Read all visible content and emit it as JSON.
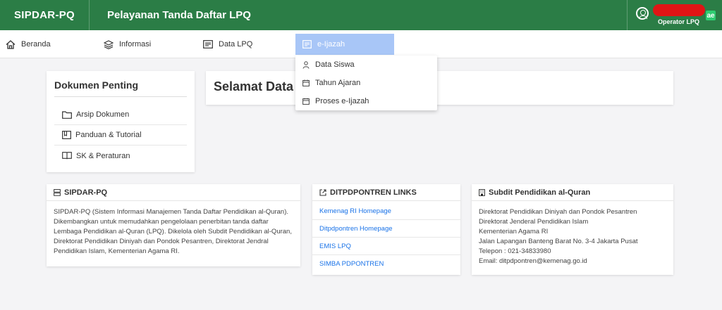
{
  "header": {
    "brand": "SIPDAR-PQ",
    "title": "Pelayanan Tanda Daftar LPQ",
    "user_role": "Operator LPQ",
    "app_badge": "ae"
  },
  "nav": {
    "items": [
      {
        "label": "Beranda",
        "icon": "home-icon"
      },
      {
        "label": "Informasi",
        "icon": "layers-icon"
      },
      {
        "label": "Data LPQ",
        "icon": "list-box-icon"
      },
      {
        "label": "e-Ijazah",
        "icon": "document-icon",
        "active": true
      }
    ]
  },
  "dropdown": {
    "items": [
      {
        "label": "Data Siswa",
        "icon": "person-icon"
      },
      {
        "label": "Tahun Ajaran",
        "icon": "calendar-icon"
      },
      {
        "label": "Proses e-Ijazah",
        "icon": "calendar-icon"
      }
    ]
  },
  "dokumen": {
    "title": "Dokumen Penting",
    "items": [
      {
        "label": "Arsip Dokumen",
        "icon": "folder-icon"
      },
      {
        "label": "Panduan & Tutorial",
        "icon": "book-icon"
      },
      {
        "label": "SK & Peraturan",
        "icon": "open-book-icon"
      }
    ]
  },
  "welcome": {
    "text": "Selamat Data"
  },
  "sipdar_card": {
    "title": "SIPDAR-PQ",
    "body": "SIPDAR-PQ (Sistem Informasi Manajemen Tanda Daftar Pendidikan al-Quran). Dikembangkan untuk memudahkan pengelolaan penerbitan tanda daftar Lembaga Pendidikan al-Quran (LPQ). Dikelola oleh Subdit Pendidikan al-Quran, Direktorat Pendidikan Diniyah dan Pondok Pesantren, Direktorat Jendral Pendidikan Islam, Kementerian Agama RI."
  },
  "links_card": {
    "title": "DITPDPONTREN LINKS",
    "links": [
      "Kemenag RI Homepage",
      "Ditpdpontren Homepage",
      "EMIS LPQ",
      "SIMBA PDPONTREN"
    ]
  },
  "subdit_card": {
    "title": "Subdit Pendidikan al-Quran",
    "lines": [
      "Direktorat Pendidikan Diniyah dan Pondok Pesantren",
      "Direktorat Jenderal Pendidikan Islam",
      "Kementerian Agama RI",
      "Jalan Lapangan Banteng Barat No. 3-4 Jakarta Pusat",
      "Telepon : 021-34833980",
      "Email: ditpdpontren@kemenag.go.id"
    ]
  },
  "colors": {
    "header_green": "#2b7d46",
    "active_tab": "#a8c6f7",
    "link_blue": "#1a73e8",
    "redaction_red": "#e01515"
  }
}
